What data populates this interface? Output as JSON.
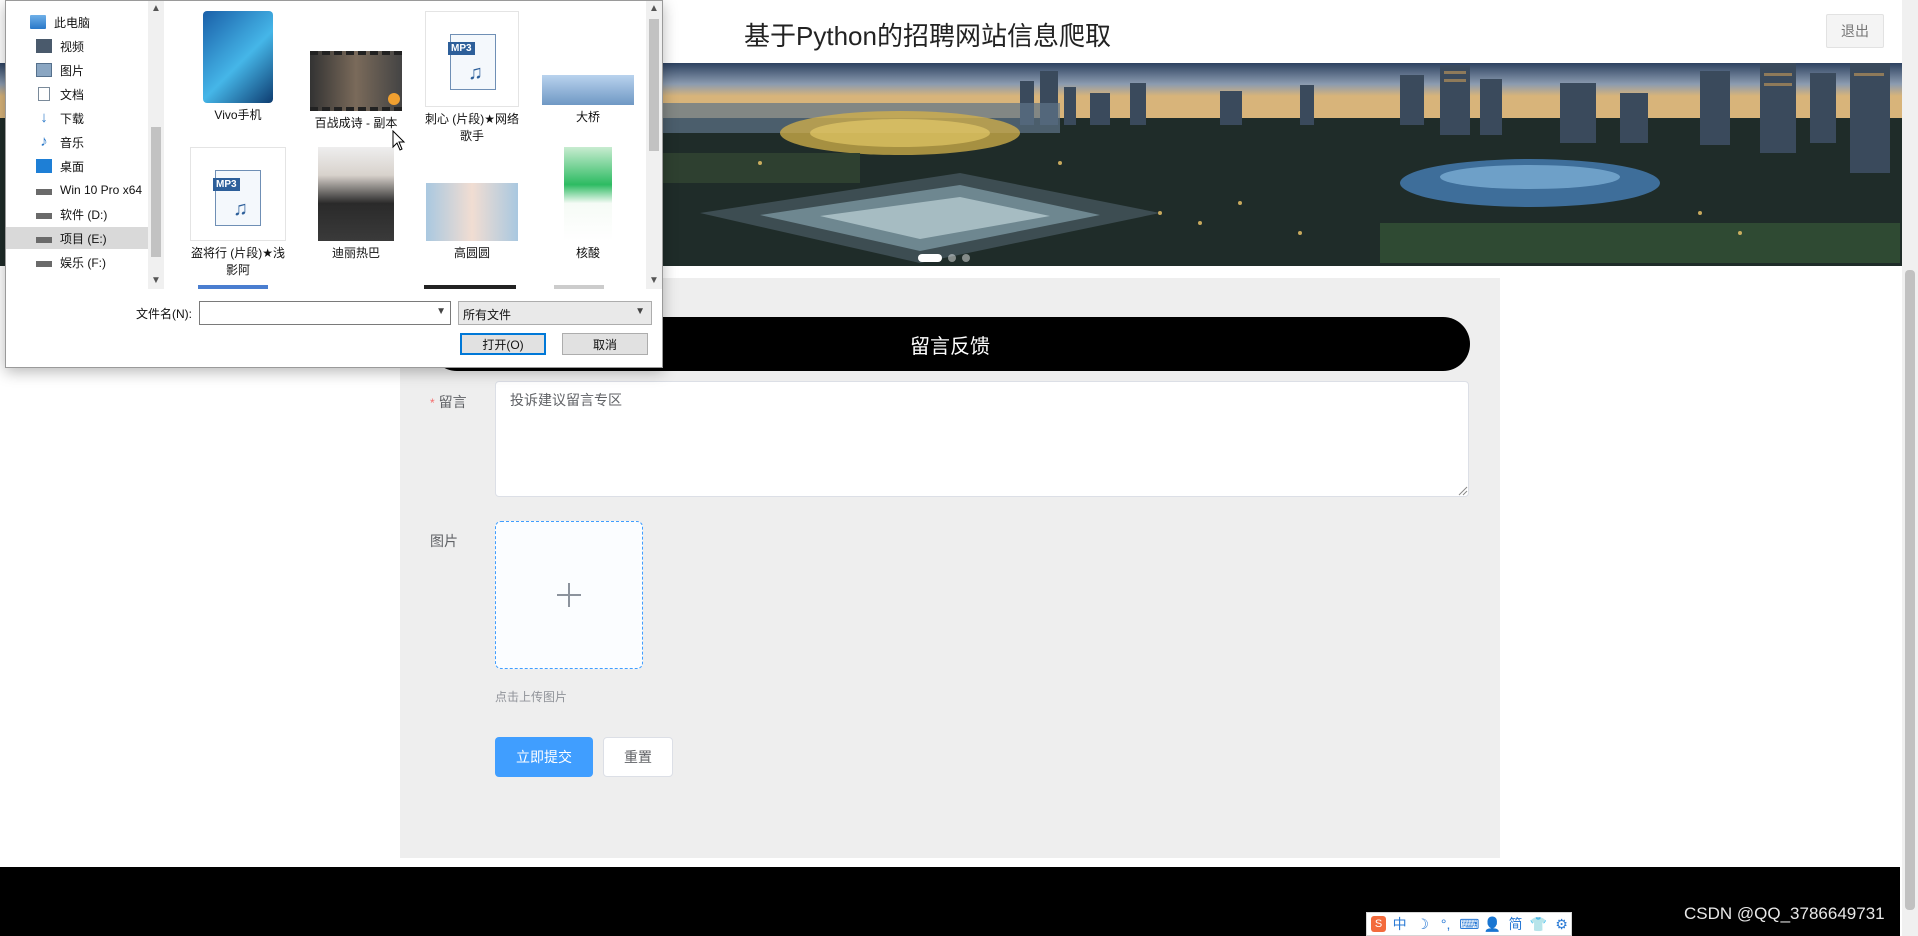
{
  "header": {
    "site_title": "基于Python的招聘网站信息爬取",
    "logout_label": "退出"
  },
  "banner": {
    "slide_count": 3,
    "active_slide": 1
  },
  "feedback_form": {
    "section_title": "留言反馈",
    "message_label": "留言",
    "message_required_mark": "*",
    "message_placeholder": "投诉建议留言专区",
    "image_label": "图片",
    "upload_hint": "点击上传图片",
    "submit_label": "立即提交",
    "reset_label": "重置"
  },
  "file_dialog": {
    "nav_items": [
      {
        "label": "此电脑",
        "icon": "computer-icon"
      },
      {
        "label": "视频",
        "icon": "video-folder-icon"
      },
      {
        "label": "图片",
        "icon": "pictures-folder-icon"
      },
      {
        "label": "文档",
        "icon": "documents-folder-icon"
      },
      {
        "label": "下载",
        "icon": "download-folder-icon"
      },
      {
        "label": "音乐",
        "icon": "music-folder-icon"
      },
      {
        "label": "桌面",
        "icon": "desktop-folder-icon"
      },
      {
        "label": "Win 10 Pro x64",
        "icon": "drive-icon"
      },
      {
        "label": "软件 (D:)",
        "icon": "drive-icon"
      },
      {
        "label": "项目 (E:)",
        "icon": "drive-icon",
        "selected": true
      },
      {
        "label": "娱乐 (F:)",
        "icon": "drive-icon"
      }
    ],
    "files": [
      {
        "name": "Vivo手机",
        "kind": "phone-image"
      },
      {
        "name": "百战成诗 - 副本",
        "kind": "video"
      },
      {
        "name": "刺心 (片段)★网络歌手",
        "kind": "mp3"
      },
      {
        "name": "大桥",
        "kind": "bridge-image"
      },
      {
        "name": "盗将行 (片段)★浅影阿",
        "kind": "mp3"
      },
      {
        "name": "迪丽热巴",
        "kind": "portrait-image"
      },
      {
        "name": "高圆圆",
        "kind": "portrait-image-2"
      },
      {
        "name": "核酸",
        "kind": "phone-screenshot"
      }
    ],
    "filename_label": "文件名(N):",
    "filename_value": "",
    "filetype_value": "所有文件",
    "open_label": "打开(O)",
    "cancel_label": "取消"
  },
  "ime_toolbar": {
    "items": [
      "中",
      "☽",
      "°,",
      "⌨",
      "👤",
      "简",
      "👕",
      "⚙"
    ]
  },
  "watermark": "CSDN @QQ_3786649731",
  "colors": {
    "primary": "#409eff",
    "feedback_bar": "#000000",
    "panel_bg": "#eeeeee",
    "footer": "#000000"
  }
}
